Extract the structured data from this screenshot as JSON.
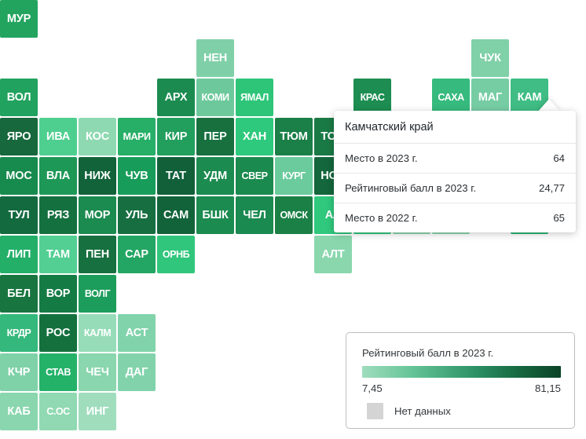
{
  "chart_data": {
    "type": "heatmap",
    "subtype": "tile-grid-cartogram",
    "title": "Рейтинговый балл в 2023 г.",
    "value_range": [
      7.45,
      81.15
    ],
    "value_range_labels": [
      "7,45",
      "81,15"
    ],
    "no_data_label": "Нет данных",
    "color_scale_low": "#9fddbe",
    "color_scale_high": "#0b4226",
    "no_data_color": "#d4d4d4",
    "cell_size": 48,
    "cell_pitch": 50,
    "tiles": [
      {
        "label": "МУР",
        "col": 0,
        "row": 0,
        "color": "#22a45f"
      },
      {
        "label": "НЕН",
        "col": 5,
        "row": 1,
        "color": "#7fd0a8"
      },
      {
        "label": "ЧУК",
        "col": 12,
        "row": 1,
        "color": "#80d0a8"
      },
      {
        "label": "ВОЛ",
        "col": 0,
        "row": 2,
        "color": "#21a25e"
      },
      {
        "label": "АРХ",
        "col": 4,
        "row": 2,
        "color": "#1c8b50"
      },
      {
        "label": "КОМИ",
        "col": 5,
        "row": 2,
        "color": "#6dc99c"
      },
      {
        "label": "ЯМАЛ",
        "col": 6,
        "row": 2,
        "color": "#2ec579"
      },
      {
        "label": "КРАС",
        "col": 9,
        "row": 2,
        "color": "#1d8d51"
      },
      {
        "label": "САХА",
        "col": 11,
        "row": 2,
        "color": "#36ba7d"
      },
      {
        "label": "МАГ",
        "col": 12,
        "row": 2,
        "color": "#76cda4"
      },
      {
        "label": "КАМ",
        "col": 13,
        "row": 2,
        "color": "#3fbd84"
      },
      {
        "label": "ЯРО",
        "col": 0,
        "row": 3,
        "color": "#17683c"
      },
      {
        "label": "ИВА",
        "col": 1,
        "row": 3,
        "color": "#4ecf90"
      },
      {
        "label": "КОС",
        "col": 2,
        "row": 3,
        "color": "#8ed9b1"
      },
      {
        "label": "МАРИ",
        "col": 3,
        "row": 3,
        "color": "#27ae67"
      },
      {
        "label": "КИР",
        "col": 4,
        "row": 3,
        "color": "#229e5d"
      },
      {
        "label": "ПЕР",
        "col": 5,
        "row": 3,
        "color": "#18703f"
      },
      {
        "label": "ХАН",
        "col": 6,
        "row": 3,
        "color": "#2ec97c"
      },
      {
        "label": "ТЮМ",
        "col": 7,
        "row": 3,
        "color": "#1b7f48"
      },
      {
        "label": "ТОМ",
        "col": 8,
        "row": 3,
        "color": "#1a7a45"
      },
      {
        "label": "МОС",
        "col": 0,
        "row": 4,
        "color": "#178a4e"
      },
      {
        "label": "ВЛА",
        "col": 1,
        "row": 4,
        "color": "#1e9857"
      },
      {
        "label": "НИЖ",
        "col": 2,
        "row": 4,
        "color": "#12623a"
      },
      {
        "label": "ЧУВ",
        "col": 3,
        "row": 4,
        "color": "#189c5a"
      },
      {
        "label": "ТАТ",
        "col": 4,
        "row": 4,
        "color": "#11603a"
      },
      {
        "label": "УДМ",
        "col": 5,
        "row": 4,
        "color": "#1c8b50"
      },
      {
        "label": "СВЕР",
        "col": 6,
        "row": 4,
        "color": "#1b8a4f"
      },
      {
        "label": "КУРГ",
        "col": 7,
        "row": 4,
        "color": "#6bcb9d"
      },
      {
        "label": "НОВ",
        "col": 8,
        "row": 4,
        "color": "#14663c"
      },
      {
        "label": "ТУЛ",
        "col": 0,
        "row": 5,
        "color": "#136a3f"
      },
      {
        "label": "РЯЗ",
        "col": 1,
        "row": 5,
        "color": "#15703f"
      },
      {
        "label": "МОР",
        "col": 2,
        "row": 5,
        "color": "#1b8b4f"
      },
      {
        "label": "УЛЬ",
        "col": 3,
        "row": 5,
        "color": "#176f41"
      },
      {
        "label": "САМ",
        "col": 4,
        "row": 5,
        "color": "#12633a"
      },
      {
        "label": "БШК",
        "col": 5,
        "row": 5,
        "color": "#1c8b50"
      },
      {
        "label": "ЧЕЛ",
        "col": 6,
        "row": 5,
        "color": "#1b8a50"
      },
      {
        "label": "ОМСК",
        "col": 7,
        "row": 5,
        "color": "#1b8046"
      },
      {
        "label": "АЛ",
        "col": 8,
        "row": 5,
        "color": "#2fc87c"
      },
      {
        "label": "ЛИП",
        "col": 0,
        "row": 6,
        "color": "#23af68"
      },
      {
        "label": "ТАМ",
        "col": 1,
        "row": 6,
        "color": "#53cf93"
      },
      {
        "label": "ПЕН",
        "col": 2,
        "row": 6,
        "color": "#17703f"
      },
      {
        "label": "САР",
        "col": 3,
        "row": 6,
        "color": "#23a663"
      },
      {
        "label": "ОРНБ",
        "col": 4,
        "row": 6,
        "color": "#30c67c"
      },
      {
        "label": "АЛТ",
        "col": 8,
        "row": 6,
        "color": "#8ad7ae"
      },
      {
        "label": "БЕЛ",
        "col": 0,
        "row": 7,
        "color": "#18753f"
      },
      {
        "label": "ВОР",
        "col": 1,
        "row": 7,
        "color": "#157b45"
      },
      {
        "label": "ВОЛГ",
        "col": 2,
        "row": 7,
        "color": "#1d9d5b"
      },
      {
        "label": "КРДР",
        "col": 0,
        "row": 8,
        "color": "#35b87c"
      },
      {
        "label": "РОС",
        "col": 1,
        "row": 8,
        "color": "#14713e"
      },
      {
        "label": "КАЛМ",
        "col": 2,
        "row": 8,
        "color": "#97dcb8"
      },
      {
        "label": "АСТ",
        "col": 3,
        "row": 8,
        "color": "#81d3ab"
      },
      {
        "label": "КЧР",
        "col": 0,
        "row": 9,
        "color": "#7fd1a8"
      },
      {
        "label": "СТАВ",
        "col": 1,
        "row": 9,
        "color": "#24b269"
      },
      {
        "label": "ЧЕЧ",
        "col": 2,
        "row": 9,
        "color": "#8ad6ae"
      },
      {
        "label": "ДАГ",
        "col": 3,
        "row": 9,
        "color": "#82d3ac"
      },
      {
        "label": "КАБ",
        "col": 0,
        "row": 10,
        "color": "#8ad6ae"
      },
      {
        "label": "С.ОС",
        "col": 1,
        "row": 10,
        "color": "#90d9b2"
      },
      {
        "label": "ИНГ",
        "col": 2,
        "row": 10,
        "color": "#a0ddbd"
      }
    ],
    "tiles_behind_tooltip": [
      {
        "label": "",
        "col": 9,
        "row": 5,
        "color": "#2fc87c"
      },
      {
        "label": "",
        "col": 10,
        "row": 5,
        "color": "#8ad6ae"
      },
      {
        "label": "",
        "col": 11,
        "row": 5,
        "color": "#8ad6ae"
      },
      {
        "label": "",
        "col": 13,
        "row": 5,
        "color": "#2bb573"
      }
    ]
  },
  "tooltip": {
    "title": "Камчатский край",
    "rows": [
      {
        "key": "Место в 2023 г.",
        "value": "64"
      },
      {
        "key": "Рейтинговый балл в 2023 г.",
        "value": "24,77"
      },
      {
        "key": "Место в 2022 г.",
        "value": "65"
      }
    ]
  },
  "legend": {
    "title": "Рейтинговый балл в 2023 г.",
    "min": "7,45",
    "max": "81,15",
    "no_data_label": "Нет данных"
  }
}
